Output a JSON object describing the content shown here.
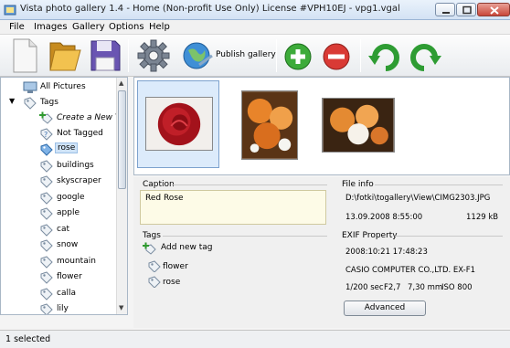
{
  "window": {
    "title": "Vista photo gallery 1.4 - Home (Non-profit Use Only) License #VPH10EJ - vpg1.vgal"
  },
  "menu": [
    {
      "label": "File"
    },
    {
      "label": "Images"
    },
    {
      "label": "Gallery"
    },
    {
      "label": "Options"
    },
    {
      "label": "Help"
    }
  ],
  "toolbar": {
    "publish_label": "Publish gallery",
    "icons": [
      "new-document-icon",
      "open-folder-icon",
      "save-disk-icon",
      "settings-gear-icon",
      "publish-globe-icon",
      "add-icon",
      "remove-icon",
      "rotate-left-icon",
      "rotate-right-icon"
    ]
  },
  "tree": {
    "items": [
      {
        "label": "All Pictures",
        "icon": "computer-icon"
      },
      {
        "label": "Tags",
        "icon": "tag-icon"
      },
      {
        "label": "Create a New Ta",
        "icon": "add-tag-icon"
      },
      {
        "label": "Not Tagged",
        "icon": "untagged-icon"
      },
      {
        "label": "rose",
        "icon": "tag-icon"
      },
      {
        "label": "buildings",
        "icon": "tag-icon"
      },
      {
        "label": "skyscraper",
        "icon": "tag-icon"
      },
      {
        "label": "google",
        "icon": "tag-icon"
      },
      {
        "label": "apple",
        "icon": "tag-icon"
      },
      {
        "label": "cat",
        "icon": "tag-icon"
      },
      {
        "label": "snow",
        "icon": "tag-icon"
      },
      {
        "label": "mountain",
        "icon": "tag-icon"
      },
      {
        "label": "flower",
        "icon": "tag-icon"
      },
      {
        "label": "calla",
        "icon": "tag-icon"
      },
      {
        "label": "lily",
        "icon": "tag-icon"
      }
    ],
    "selected": "rose"
  },
  "thumbnails": [
    {
      "name": "red-rose-photo",
      "selected": true
    },
    {
      "name": "orange-flowers-photo",
      "selected": false
    },
    {
      "name": "orange-bouquet-photo",
      "selected": false
    }
  ],
  "caption": {
    "title": "Caption",
    "value": "Red Rose"
  },
  "tags": {
    "title": "Tags",
    "add_label": "Add new tag",
    "items": [
      "flower",
      "rose"
    ]
  },
  "file_info": {
    "title": "File info",
    "path": "D:\\fotki\\togallery\\View\\CIMG2303.JPG",
    "date": "13.09.2008 8:55:00",
    "size": "1129 kB"
  },
  "exif": {
    "title": "EXIF Property",
    "datetime": "2008:10:21 17:48:23",
    "camera": "CASIO COMPUTER CO.,LTD. EX-F1",
    "exposure": "1/200 sec",
    "aperture": "F2,7",
    "focal": "7,30 mm",
    "iso": "ISO 800",
    "advanced_label": "Advanced"
  },
  "status": {
    "text": "1 selected"
  }
}
